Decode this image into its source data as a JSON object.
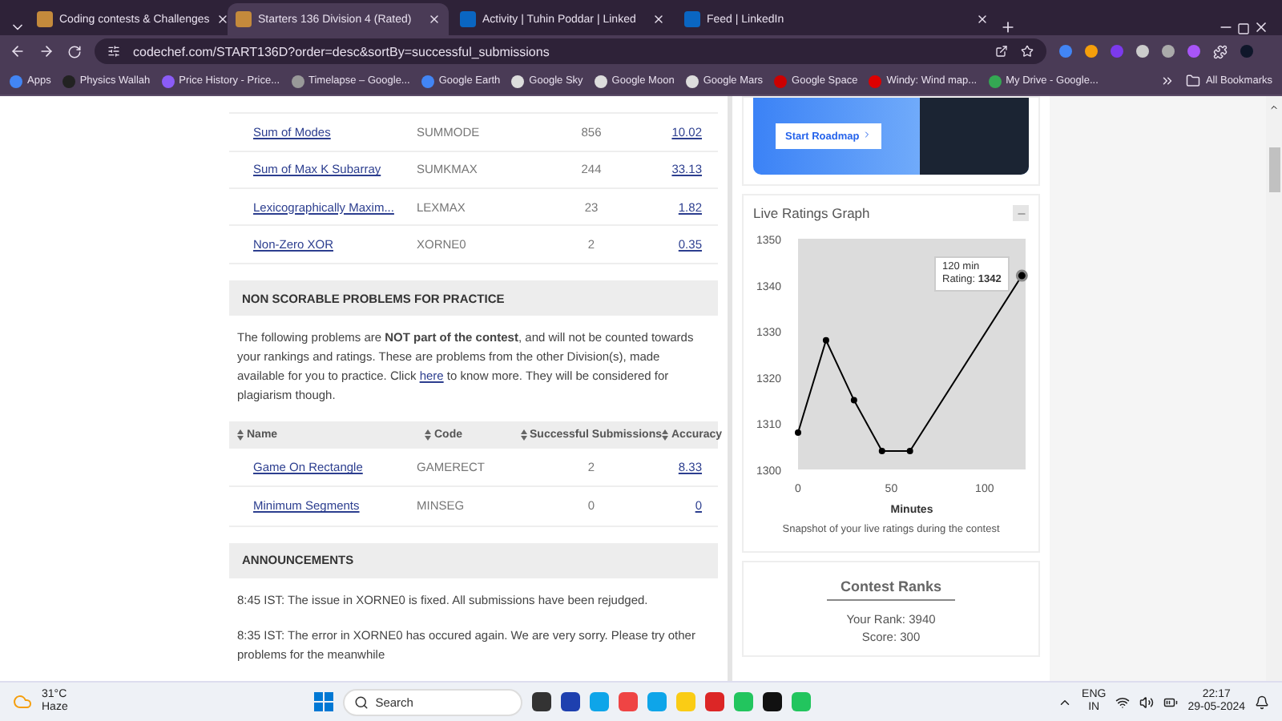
{
  "browser": {
    "tabs": [
      {
        "title": "Coding contests & Challenges",
        "selected": false
      },
      {
        "title": "Starters 136 Division 4 (Rated)",
        "selected": true
      },
      {
        "title": "Activity | Tuhin Poddar | Linked",
        "selected": false
      },
      {
        "title": "Feed | LinkedIn",
        "selected": false
      }
    ],
    "url": "codechef.com/START136D?order=desc&sortBy=successful_submissions",
    "bookmarks": [
      "Apps",
      "Physics Wallah",
      "Price History - Price...",
      "Timelapse – Google...",
      "Google Earth",
      "Google Sky",
      "Google Moon",
      "Google Mars",
      "Google Space",
      "Windy: Wind map...",
      "My Drive - Google..."
    ],
    "all_bookmarks": "All Bookmarks"
  },
  "problems": [
    {
      "name": "Sum of Modes",
      "code": "SUMMODE",
      "submissions": "856",
      "accuracy": "10.02"
    },
    {
      "name": "Sum of Max K Subarray",
      "code": "SUMKMAX",
      "submissions": "244",
      "accuracy": "33.13"
    },
    {
      "name": "Lexicographically Maxim...",
      "code": "LEXMAX",
      "submissions": "23",
      "accuracy": "1.82"
    },
    {
      "name": "Non-Zero XOR",
      "code": "XORNE0",
      "submissions": "2",
      "accuracy": "0.35"
    }
  ],
  "practice": {
    "title": "NON SCORABLE PROBLEMS FOR PRACTICE",
    "text_before": "The following problems are **NOT part of the contest**, and will not be counted towards your rankings and ratings. These are problems from the other Division(s), made available for you to practice. Click ",
    "link": "here",
    "text_after": " to know more. They will be considered for plagiarism though.",
    "columns": [
      "Name",
      "Code",
      "Successful Submissions",
      "Accuracy"
    ],
    "rows": [
      {
        "name": "Game On Rectangle",
        "code": "GAMERECT",
        "submissions": "2",
        "accuracy": "8.33"
      },
      {
        "name": "Minimum Segments",
        "code": "MINSEG",
        "submissions": "0",
        "accuracy": "0"
      }
    ]
  },
  "announcements": {
    "title": "ANNOUNCEMENTS",
    "items": [
      "8:45 IST: The issue in XORNE0 is fixed. All submissions have been rejudged.",
      "8:35 IST: The error in XORNE0 has occured again. We are very sorry. Please try other problems for the meanwhile"
    ]
  },
  "roadmap": {
    "button": "Start Roadmap"
  },
  "ratings": {
    "title": "Live Ratings Graph",
    "tooltip_title": "120 min",
    "tooltip_text": "Rating: **1342**",
    "caption": "Snapshot of your live ratings during the contest",
    "chart_data": {
      "type": "line",
      "xlabel": "Minutes",
      "x": [
        0,
        15,
        30,
        45,
        60,
        120
      ],
      "series": [
        {
          "marker": "circle",
          "color": "#000000",
          "values": [
            1308,
            1328,
            1315,
            1304,
            1304,
            1342
          ]
        }
      ],
      "xlim": [
        0,
        122
      ],
      "ylim": [
        1300,
        1350
      ],
      "xticks": [
        0,
        50,
        100
      ],
      "yticks": [
        1300,
        1310,
        1320,
        1330,
        1340,
        1350
      ]
    }
  },
  "ranks": {
    "title": "Contest Ranks",
    "rank": "Your Rank: 3940",
    "score": "Score: 300"
  },
  "taskbar": {
    "temperature": "31°C",
    "weather": "Haze",
    "search": "Search",
    "language": "ENG",
    "region": "IN",
    "time": "22:17",
    "date": "29-05-2024"
  }
}
